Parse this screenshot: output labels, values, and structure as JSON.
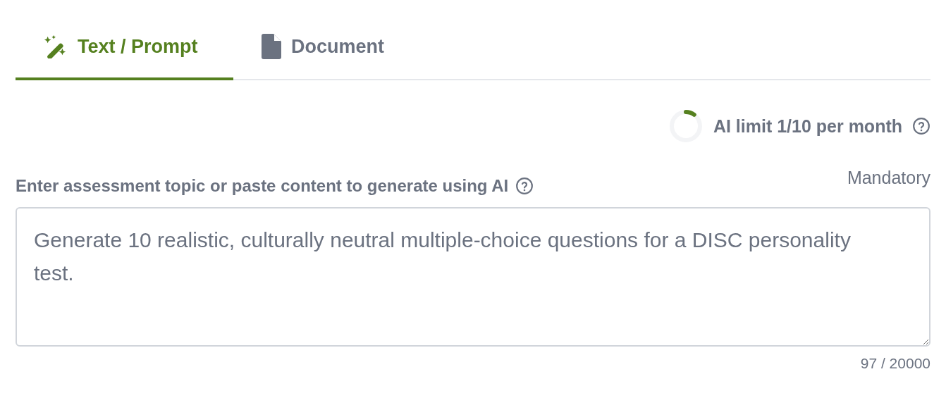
{
  "tabs": [
    {
      "label": "Text / Prompt",
      "kind": "wand",
      "selected": true
    },
    {
      "label": "Document",
      "kind": "file",
      "selected": false
    }
  ],
  "usage": {
    "level": 0.1,
    "label": "AI limit 1/10 per month"
  },
  "prompt_field": {
    "label": "Enter assessment topic or paste content to generate using AI",
    "requirement": "Mandatory",
    "value": "Generate 10 realistic, culturally neutral multiple-choice questions for a DISC personality test.",
    "counter": "97 / 20000"
  }
}
